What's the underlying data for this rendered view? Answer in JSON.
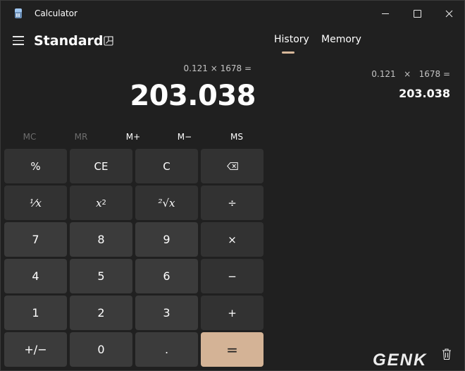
{
  "window": {
    "title": "Calculator"
  },
  "header": {
    "mode_title": "Standard",
    "tabs": [
      {
        "label": "History",
        "active": true
      },
      {
        "label": "Memory",
        "active": false
      }
    ]
  },
  "display": {
    "expression": "0.121 × 1678 =",
    "result": "203.038"
  },
  "memory_buttons": [
    {
      "label": "MC",
      "enabled": false
    },
    {
      "label": "MR",
      "enabled": false
    },
    {
      "label": "M+",
      "enabled": true
    },
    {
      "label": "M−",
      "enabled": true
    },
    {
      "label": "MS",
      "enabled": true
    }
  ],
  "keys": {
    "percent": "%",
    "ce": "CE",
    "c": "C",
    "reciprocal": "⅟x",
    "square_base": "x",
    "square_exp": "2",
    "sqrt": "²√x",
    "divide": "÷",
    "seven": "7",
    "eight": "8",
    "nine": "9",
    "multiply": "×",
    "four": "4",
    "five": "5",
    "six": "6",
    "subtract": "−",
    "one": "1",
    "two": "2",
    "three": "3",
    "add": "+",
    "negate": "+/−",
    "zero": "0",
    "decimal": ".",
    "equals": "="
  },
  "history": {
    "items": [
      {
        "expression": "0.121   ×   1678 =",
        "result": "203.038"
      }
    ]
  },
  "watermark": "GENK",
  "colors": {
    "background": "#202020",
    "key_number": "#3b3b3b",
    "key_operator": "#323232",
    "accent_equals": "#d4b396"
  },
  "icons": {
    "backspace": "backspace-icon",
    "keep_on_top": "keep-on-top-icon",
    "menu": "hamburger-icon",
    "delete_history": "trash-icon"
  }
}
